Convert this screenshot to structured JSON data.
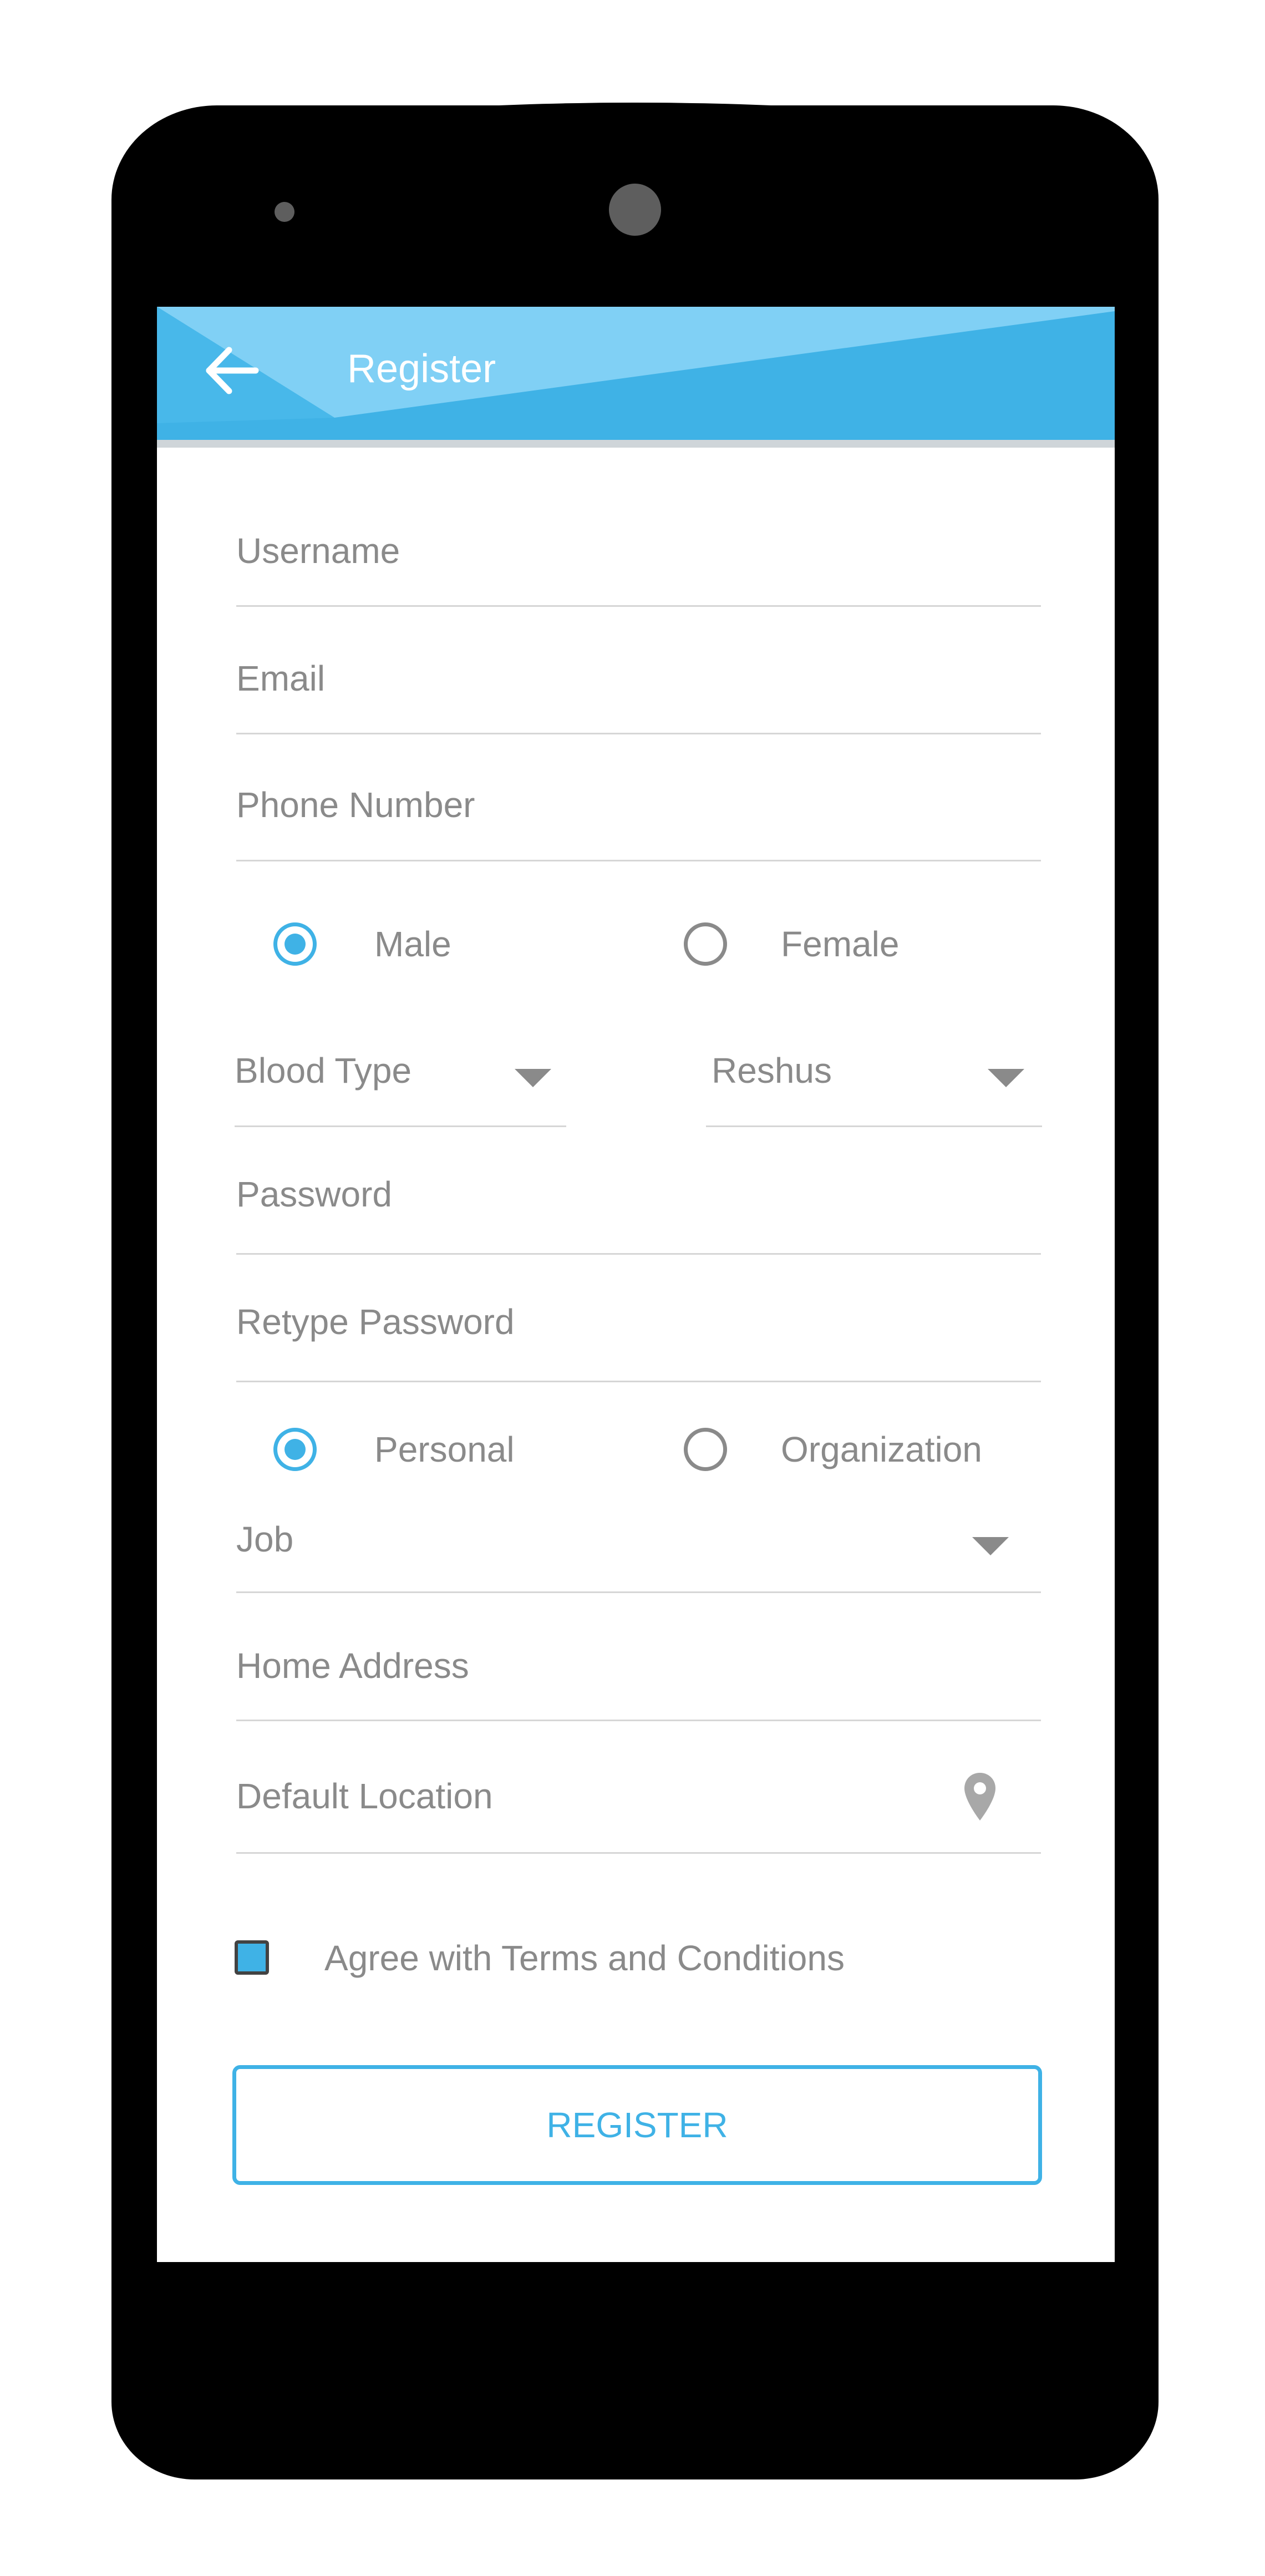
{
  "app_bar": {
    "title": "Register",
    "back_icon": "arrow-left-icon",
    "colors": {
      "primary": "#3fb2e6",
      "light": "#80d0f5"
    }
  },
  "form": {
    "username_placeholder": "Username",
    "email_placeholder": "Email",
    "phone_placeholder": "Phone Number",
    "gender": {
      "options": [
        "Male",
        "Female"
      ],
      "selected": "Male"
    },
    "blood_type": {
      "placeholder": "Blood Type"
    },
    "rhesus": {
      "placeholder": "Reshus"
    },
    "password_placeholder": "Password",
    "retype_password_placeholder": "Retype Password",
    "account_type": {
      "options": [
        "Personal",
        "Organization"
      ],
      "selected": "Personal"
    },
    "job": {
      "placeholder": "Job"
    },
    "home_address_placeholder": "Home Address",
    "default_location_placeholder": "Default Location",
    "location_icon": "map-pin-icon",
    "terms_label": "Agree with Terms and Conditions",
    "terms_checked": true,
    "register_label": "REGISTER"
  },
  "colors": {
    "accent": "#3fb2e6",
    "text_muted": "#8a8a8a",
    "divider": "#d6d6d6",
    "device": "#000000"
  }
}
